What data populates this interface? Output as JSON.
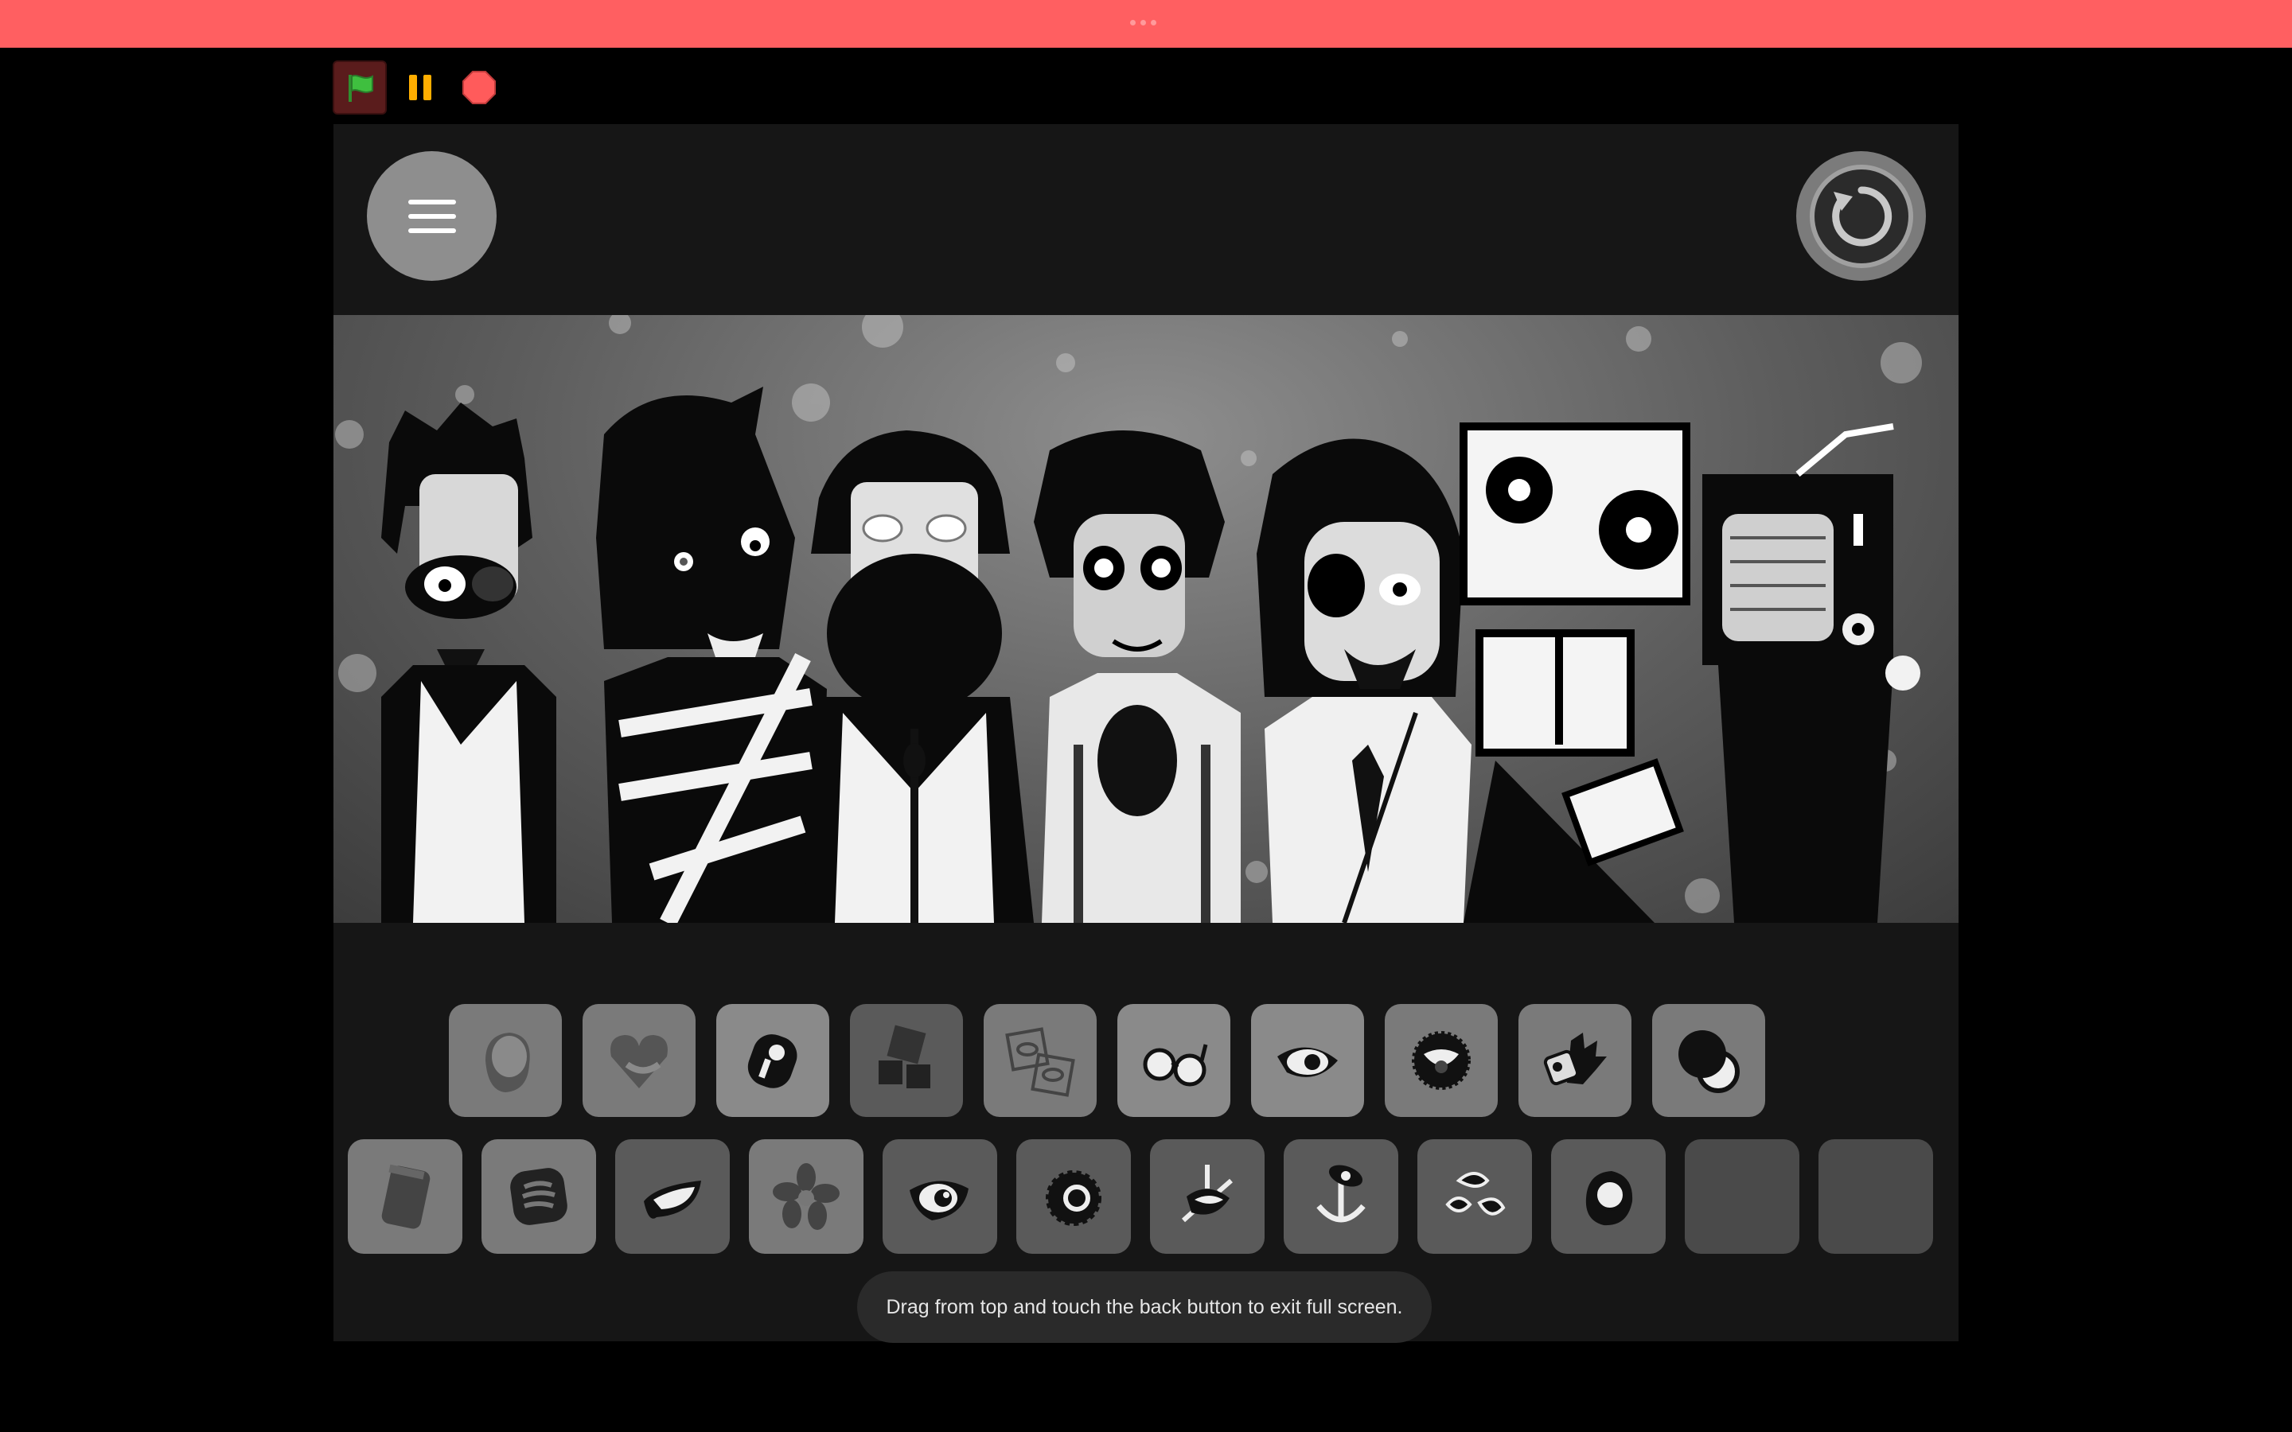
{
  "window": {
    "topbar_color": "#ff5f61"
  },
  "controls": {
    "green_flag": "green-flag-icon",
    "pause": "pause-icon",
    "stop": "stop-icon"
  },
  "stage": {
    "menu_icon": "hamburger-menu-icon",
    "reset_icon": "reset-icon",
    "characters": [
      "character-1",
      "character-2",
      "character-3",
      "character-4",
      "character-5",
      "character-6",
      "character-7",
      "character-8"
    ]
  },
  "sound_icons": {
    "row1": [
      "blob-icon",
      "heart-icon",
      "key-icon",
      "squares-icon",
      "eyes-icon",
      "glasses-icon",
      "eye-icon",
      "spiky-mouth-icon",
      "hand-icon",
      "circles-icon"
    ],
    "row2": [
      "tag-icon",
      "stripes-icon",
      "lips-icon",
      "flower-icon",
      "eye-dark-icon",
      "ring-icon",
      "spark-icon",
      "anchor-icon",
      "splat-icon",
      "orb-icon",
      "empty-slot",
      "empty-slot"
    ]
  },
  "toast": {
    "message": "Drag from top and touch the back button to exit full screen."
  }
}
